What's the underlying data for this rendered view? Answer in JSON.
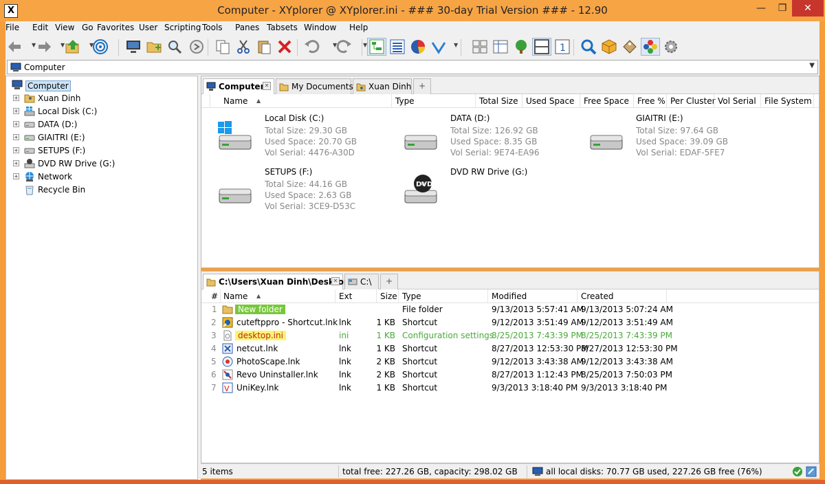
{
  "window": {
    "title": "Computer - XYplorer @ XYplorer.ini - ### 30-day Trial Version ### - 12.90",
    "app_icon_glyph": "X",
    "title_color": "#f7a445",
    "close_color": "#c7362c"
  },
  "menu": [
    "File",
    "Edit",
    "View",
    "Go",
    "Favorites",
    "User",
    "Scripting",
    "Tools",
    "Panes",
    "Tabsets",
    "Window",
    "Help"
  ],
  "toolbar": {
    "icons": [
      "back-icon",
      "forward-icon",
      "up-folder-icon",
      "target-icon",
      "computer-icon",
      "new-folder-icon",
      "find-icon",
      "refresh-icon",
      "copy-icon",
      "cut-icon",
      "paste-icon",
      "delete-icon",
      "undo-icon",
      "redo-icon",
      "tree-view-icon",
      "list-view-icon",
      "pie-chart-icon",
      "check-icon",
      "panes-icon",
      "details-icon",
      "tree-icon",
      "dual-pane-icon",
      "single-pane-icon",
      "search-icon",
      "box-icon",
      "tag-icon",
      "colors-icon",
      "settings-icon"
    ]
  },
  "address": {
    "value": "Computer"
  },
  "tree": {
    "root": "Computer",
    "items": [
      {
        "label": "Xuan Dinh",
        "icon": "user-folder-icon"
      },
      {
        "label": "Local Disk (C:)",
        "icon": "windows-drive-icon"
      },
      {
        "label": "DATA (D:)",
        "icon": "drive-icon"
      },
      {
        "label": "GIAITRI (E:)",
        "icon": "drive-icon"
      },
      {
        "label": "SETUPS (F:)",
        "icon": "drive-icon"
      },
      {
        "label": "DVD RW Drive (G:)",
        "icon": "dvd-icon"
      },
      {
        "label": "Network",
        "icon": "network-icon"
      },
      {
        "label": "Recycle Bin",
        "icon": "recycle-bin-icon"
      }
    ]
  },
  "pane1": {
    "tabs": [
      {
        "label": "Computer",
        "active": true
      },
      {
        "label": "My Documents",
        "active": false
      },
      {
        "label": "Xuan Dinh",
        "active": false
      }
    ],
    "new_tab_glyph": "+",
    "columns": [
      "Name",
      "Type",
      "Total Size",
      "Used Space",
      "Free Space",
      "Free %",
      "Per Cluster",
      "Vol Serial",
      "File System"
    ],
    "drives": [
      {
        "name": "Local Disk (C:)",
        "kind": "windows",
        "lines": [
          "Total Size: 29.30 GB",
          "Used Space: 20.70 GB",
          "Vol Serial: 4476-A30D"
        ]
      },
      {
        "name": "DATA (D:)",
        "kind": "hdd",
        "lines": [
          "Total Size: 126.92 GB",
          "Used Space: 8.35 GB",
          "Vol Serial: 9E74-EA96"
        ]
      },
      {
        "name": "GIAITRI (E:)",
        "kind": "hdd",
        "lines": [
          "Total Size: 97.64 GB",
          "Used Space: 39.09 GB",
          "Vol Serial: EDAF-5FE7"
        ]
      },
      {
        "name": "SETUPS (F:)",
        "kind": "hdd",
        "lines": [
          "Total Size: 44.16 GB",
          "Used Space: 2.63 GB",
          "Vol Serial: 3CE9-D53C"
        ]
      },
      {
        "name": "DVD RW Drive (G:)",
        "kind": "dvd",
        "lines": [],
        "badge": "DVD"
      }
    ]
  },
  "pane2": {
    "tabs": [
      {
        "label": "C:\\Users\\Xuan Dinh\\Desktop",
        "active": true
      },
      {
        "label": "C:\\",
        "active": false
      }
    ],
    "new_tab_glyph": "+",
    "columns": [
      "#",
      "Name",
      "Ext",
      "Size",
      "Type",
      "Modified",
      "Created"
    ],
    "rows": [
      {
        "num": "1",
        "name": "New folder",
        "ext": "",
        "size": "",
        "type": "File folder",
        "modified": "9/13/2013 5:57:41 AM",
        "created": "9/13/2013 5:07:24 AM",
        "icon": "folder-icon",
        "style": "green"
      },
      {
        "num": "2",
        "name": "cuteftppro - Shortcut.lnk",
        "ext": "lnk",
        "size": "1 KB",
        "type": "Shortcut",
        "modified": "9/12/2013 3:51:49 AM",
        "created": "9/12/2013 3:51:49 AM",
        "icon": "cuteftp-icon",
        "style": ""
      },
      {
        "num": "3",
        "name": "desktop.ini",
        "ext": "ini",
        "size": "1 KB",
        "type": "Configuration settings",
        "modified": "8/25/2013 7:43:39 PM",
        "created": "8/25/2013 7:43:39 PM",
        "icon": "ini-file-icon",
        "style": "yellow"
      },
      {
        "num": "4",
        "name": "netcut.lnk",
        "ext": "lnk",
        "size": "1 KB",
        "type": "Shortcut",
        "modified": "8/27/2013 12:53:30 PM",
        "created": "8/27/2013 12:53:30 PM",
        "icon": "netcut-icon",
        "style": ""
      },
      {
        "num": "5",
        "name": "PhotoScape.lnk",
        "ext": "lnk",
        "size": "2 KB",
        "type": "Shortcut",
        "modified": "9/12/2013 3:43:38 AM",
        "created": "9/12/2013 3:43:38 AM",
        "icon": "photoscape-icon",
        "style": ""
      },
      {
        "num": "6",
        "name": "Revo Uninstaller.lnk",
        "ext": "lnk",
        "size": "2 KB",
        "type": "Shortcut",
        "modified": "8/27/2013 1:12:43 PM",
        "created": "8/25/2013 7:50:03 PM",
        "icon": "revo-icon",
        "style": ""
      },
      {
        "num": "7",
        "name": "UniKey.lnk",
        "ext": "lnk",
        "size": "1 KB",
        "type": "Shortcut",
        "modified": "9/3/2013 3:18:40 PM",
        "created": "9/3/2013 3:18:40 PM",
        "icon": "unikey-icon",
        "style": ""
      }
    ]
  },
  "status": {
    "items": "5 items",
    "free": "total free: 227.26 GB, capacity: 298.02 GB",
    "disks": "all local disks: 70.77 GB used, 227.26 GB free (76%)"
  }
}
